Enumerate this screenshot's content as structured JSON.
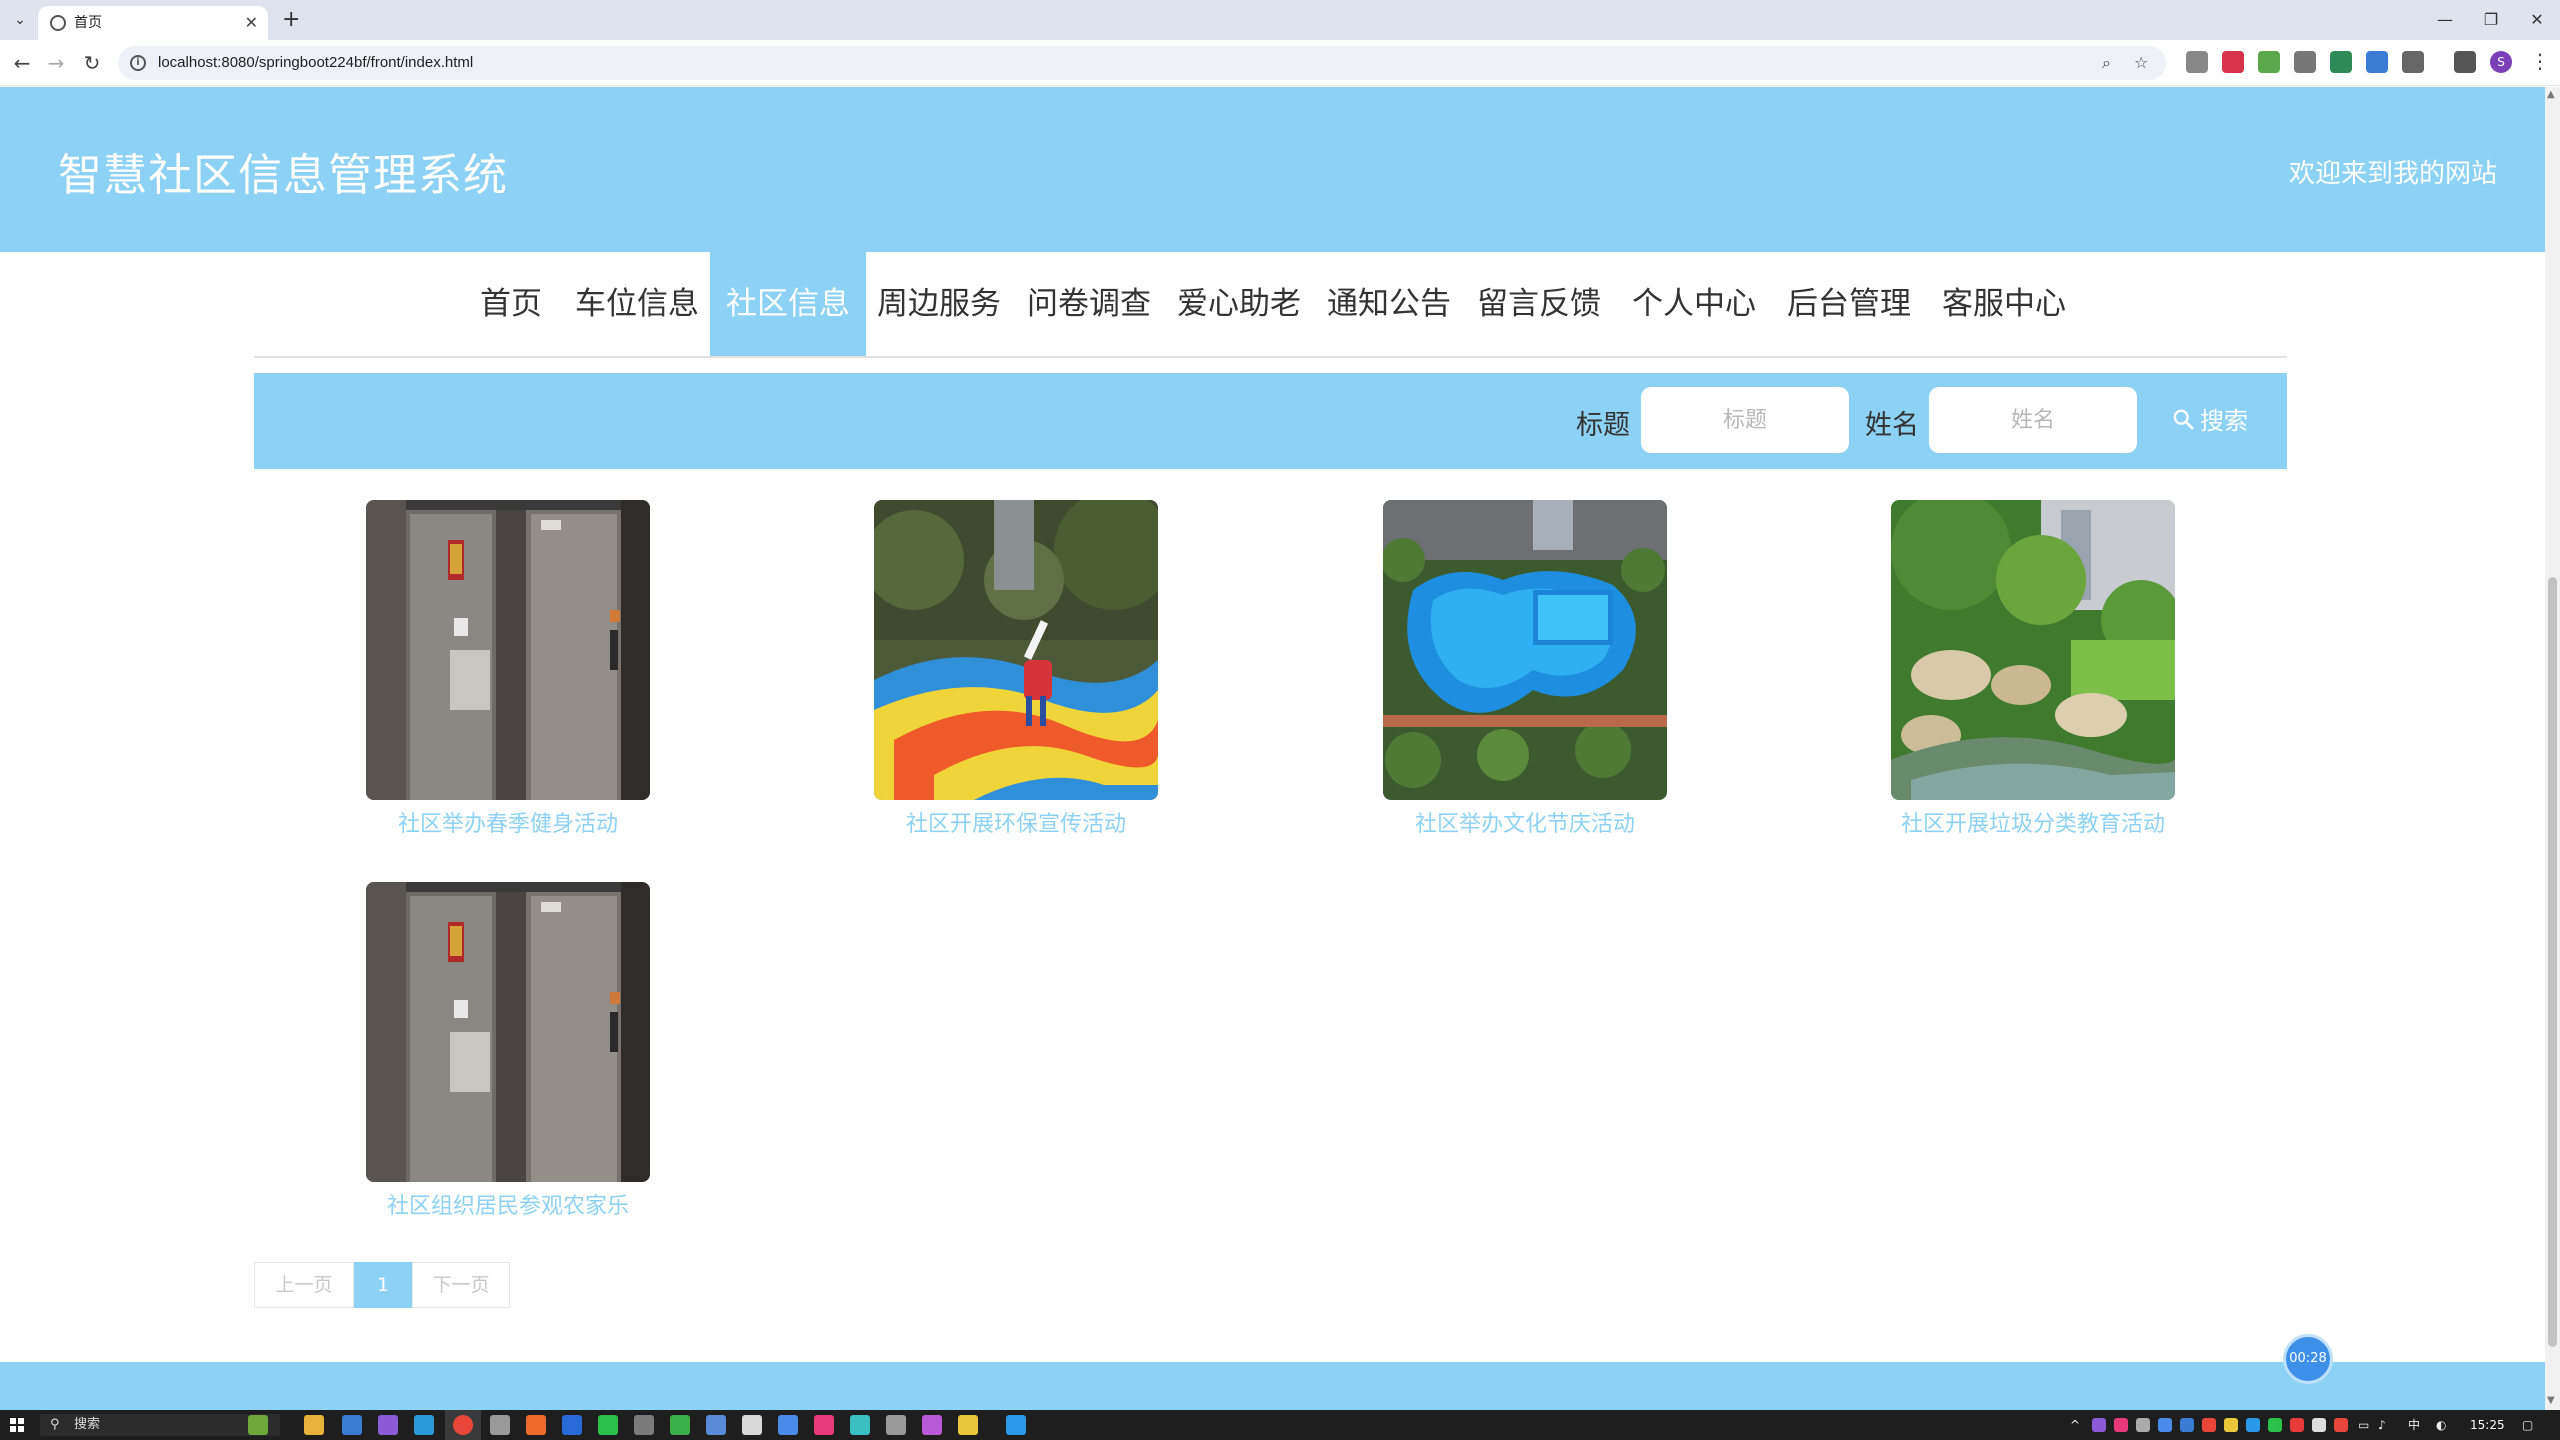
{
  "browser": {
    "tab_title": "首页",
    "tab_close": "✕",
    "new_tab": "+",
    "url": "localhost:8080/springboot224bf/front/index.html",
    "profile_initial": "S"
  },
  "site": {
    "title": "智慧社区信息管理系统",
    "welcome": "欢迎来到我的网站"
  },
  "nav": {
    "items": [
      {
        "label": "首页",
        "active": false
      },
      {
        "label": "车位信息",
        "active": false
      },
      {
        "label": "社区信息",
        "active": true
      },
      {
        "label": "周边服务",
        "active": false
      },
      {
        "label": "问卷调查",
        "active": false
      },
      {
        "label": "爱心助老",
        "active": false
      },
      {
        "label": "通知公告",
        "active": false
      },
      {
        "label": "留言反馈",
        "active": false
      },
      {
        "label": "个人中心",
        "active": false
      },
      {
        "label": "后台管理",
        "active": false
      },
      {
        "label": "客服中心",
        "active": false
      }
    ]
  },
  "search": {
    "title_label": "标题",
    "title_placeholder": "标题",
    "name_label": "姓名",
    "name_placeholder": "姓名",
    "button_label": "搜索"
  },
  "cards": [
    {
      "title": "社区举办春季健身活动",
      "image": "elevator-lobby"
    },
    {
      "title": "社区开展环保宣传活动",
      "image": "colorful-playground"
    },
    {
      "title": "社区举办文化节庆活动",
      "image": "swimming-pool"
    },
    {
      "title": "社区开展垃圾分类教育活动",
      "image": "garden-stream"
    },
    {
      "title": "社区组织居民参观农家乐",
      "image": "elevator-lobby"
    }
  ],
  "pagination": {
    "prev": "上一页",
    "current": "1",
    "next": "下一页"
  },
  "timer": "00:28",
  "taskbar": {
    "search_text": "搜索",
    "ime": "中",
    "time": "15:25"
  },
  "colors": {
    "theme": "#8dd2f4",
    "white": "#ffffff"
  }
}
